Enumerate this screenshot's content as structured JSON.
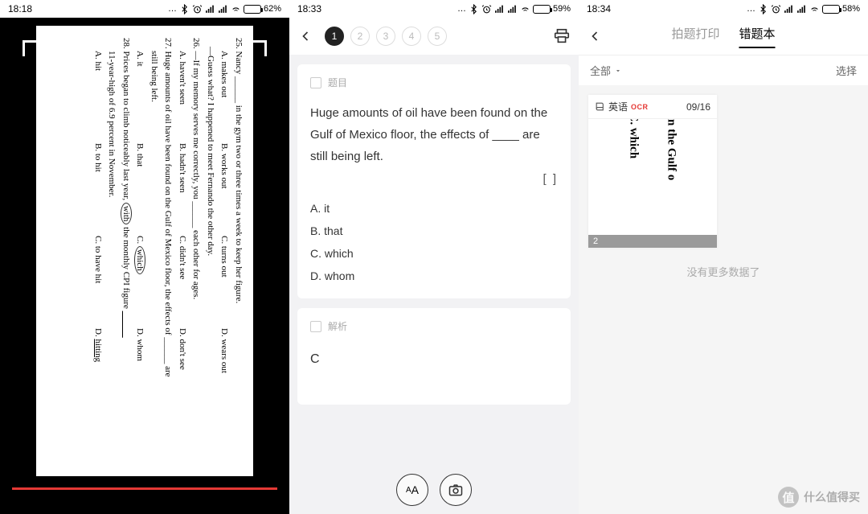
{
  "statusbar": {
    "phone1": {
      "time": "18:18",
      "battery": "62%",
      "battery_pct": 62
    },
    "phone2": {
      "time": "18:33",
      "battery": "59%",
      "battery_pct": 59
    },
    "phone3": {
      "time": "18:34",
      "battery": "58%",
      "battery_pct": 58
    }
  },
  "phone1": {
    "document_questions": [
      {
        "num": "25.",
        "text": "Nancy ______ in the gym two or three times a week to keep her figure.",
        "opts": [
          "A. makes out",
          "B. works out",
          "C. turns out",
          "D. wears out"
        ]
      },
      {
        "num": "26.",
        "text": "—If my memory serves me correctly, you ______ each other for ages.",
        "sub": "—Guess what? I happened to meet Fernando the other day.",
        "opts": [
          "A. haven't seen",
          "B. hadn't seen",
          "C. didn't see",
          "D. don't see"
        ]
      },
      {
        "num": "27.",
        "text": "Huge amounts of oil have been found on the Gulf of Mexico floor, the effects of ______ are still being left.",
        "opts": [
          "A. it",
          "B. that",
          "C. which",
          "D. whom"
        ],
        "circled": 2
      },
      {
        "num": "28.",
        "text": "Prices began to climb noticeably last year, with the monthly CPI figure ______ 11-year-high of 6.9 percent in November.",
        "opts": [
          "A. hit",
          "B. to hit",
          "C. to have hit",
          "D. hitting"
        ],
        "circled": 3
      }
    ]
  },
  "phone2": {
    "pages": [
      "1",
      "2",
      "3",
      "4",
      "5"
    ],
    "active_page": 0,
    "card1": {
      "label": "题目",
      "question": "Huge amounts of oil have been found on the Gulf of Mexico floor, the effects of ____ are still being left.",
      "brackets": "[ ]",
      "options": [
        "A. it",
        "B. that",
        "C. which",
        "D. whom"
      ]
    },
    "card2": {
      "label": "解析",
      "answer": "C"
    },
    "font_btn": "AA"
  },
  "phone3": {
    "tabs": [
      "拍题打印",
      "错题本"
    ],
    "active_tab": 1,
    "filter": {
      "all": "全部",
      "select": "选择"
    },
    "thumb": {
      "subject": "英语",
      "ocr": "OCR",
      "date": "09/16",
      "preview_lines": [
        "on the Gulf o",
        "C. which"
      ],
      "count": "2"
    },
    "nomore": "没有更多数据了"
  },
  "watermark": {
    "icon": "值",
    "text": "什么值得买"
  }
}
